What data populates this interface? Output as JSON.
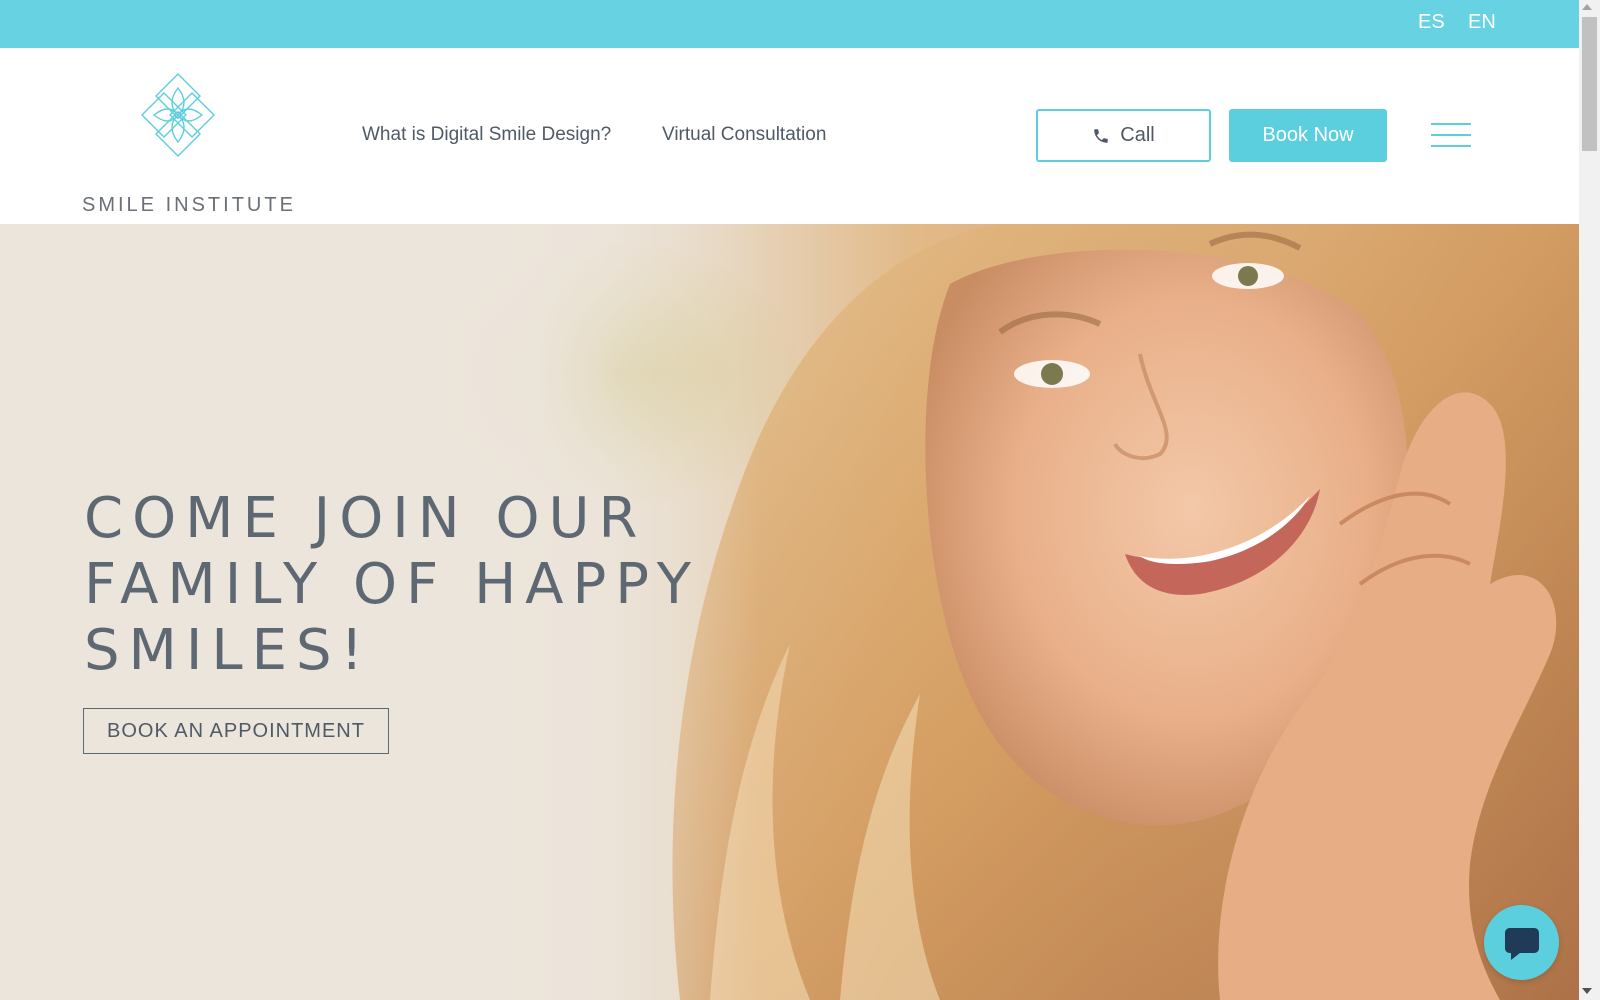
{
  "topbar": {
    "languages": [
      "ES",
      "EN"
    ],
    "color": "#67d2e1"
  },
  "header": {
    "logo_text": "SMILE INSTITUTE",
    "nav": [
      "What is Digital Smile Design?",
      "Virtual Consultation"
    ],
    "call_label": "Call",
    "book_label": "Book Now",
    "accent_color": "#5ccfdf",
    "icons": {
      "phone": "phone-icon",
      "menu": "hamburger-menu-icon",
      "logo": "flower-logo-icon"
    }
  },
  "hero": {
    "title_lines": [
      "COME JOIN OUR",
      "FAMILY OF HAPPY",
      "SMILES!"
    ],
    "cta_label": "BOOK AN APPOINTMENT",
    "photo": "smiling-woman-photo"
  },
  "chat": {
    "icon": "chat-bubble-icon"
  }
}
